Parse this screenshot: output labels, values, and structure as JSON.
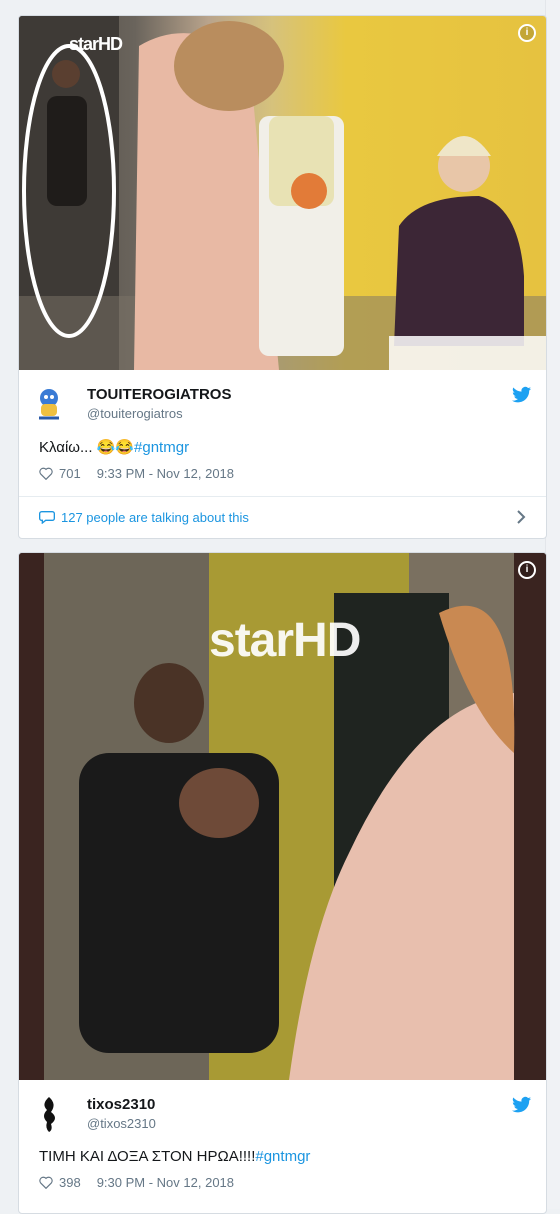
{
  "tweet1": {
    "media_logo": "starHD",
    "author_name": "TOUITEROGIATROS",
    "author_handle": "@touiterogiatros",
    "text_main": "Κλαίω... 😂😂",
    "text_hashtag": "#gntmgr",
    "likes": "701",
    "timestamp": "9:33 PM - Nov 12, 2018",
    "talking": "127 people are talking about this"
  },
  "tweet2": {
    "media_logo": "starHD",
    "author_name": "tixos2310",
    "author_handle": "@tixos2310",
    "text_main": "ΤΙΜΗ ΚΑΙ ΔΟΞΑ ΣΤΟΝ ΗΡΩΑ!!!!",
    "text_hashtag": "#gntmgr",
    "likes": "398",
    "timestamp": "9:30 PM - Nov 12, 2018"
  },
  "colors": {
    "link": "#1b95e0",
    "muted": "#657786",
    "text": "#14171a"
  },
  "icons": [
    "info-icon",
    "twitter-bird-icon",
    "heart-icon",
    "chat-bubble-icon",
    "chevron-right-icon"
  ]
}
